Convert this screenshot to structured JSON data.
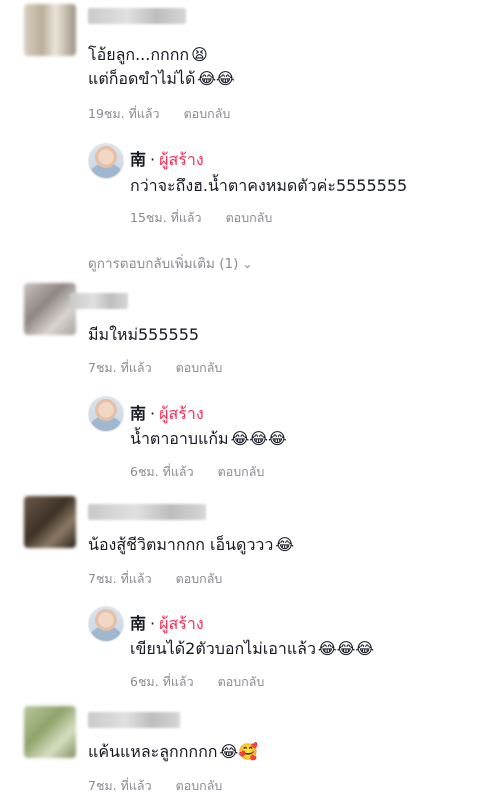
{
  "meta_reply_label": "ตอบกลับ",
  "author_badge": "ผู้สร้าง",
  "comments": [
    {
      "lines": [
        "โอ้ยลูก...กกกก",
        "แต่ก็อดขำไม่ได้"
      ],
      "emojis_line1": "😫",
      "emojis_line2": "😂😂",
      "time": "19ชม. ที่แล้ว",
      "reply": {
        "author": "南",
        "text": "กว่าจะถึงฮ.น้ำตาคงหมดตัวค่ะ5555555",
        "emojis": "",
        "time": "15ชม. ที่แล้ว"
      },
      "more_replies": "ดูการตอบกลับเพิ่มเติม (1)"
    },
    {
      "text": "มีมใหม่555555",
      "emojis": "",
      "time": "7ชม. ที่แล้ว",
      "reply": {
        "author": "南",
        "text": "น้ำตาอาบแก้ม",
        "emojis": "😂😂😂",
        "time": "6ชม. ที่แล้ว"
      }
    },
    {
      "text": "น้องสู้ชีวิตมากกก เอ็นดูววว",
      "emojis": "😂",
      "time": "7ชม. ที่แล้ว",
      "reply": {
        "author": "南",
        "text": "เขียนได้2ตัวบอกไม่เอาแล้ว",
        "emojis": "😂😂😂",
        "time": "6ชม. ที่แล้ว"
      }
    },
    {
      "text": "แค้นแหละลูกกกกก",
      "emojis": "😂🥰",
      "time": "7ชม. ที่แล้ว"
    }
  ]
}
